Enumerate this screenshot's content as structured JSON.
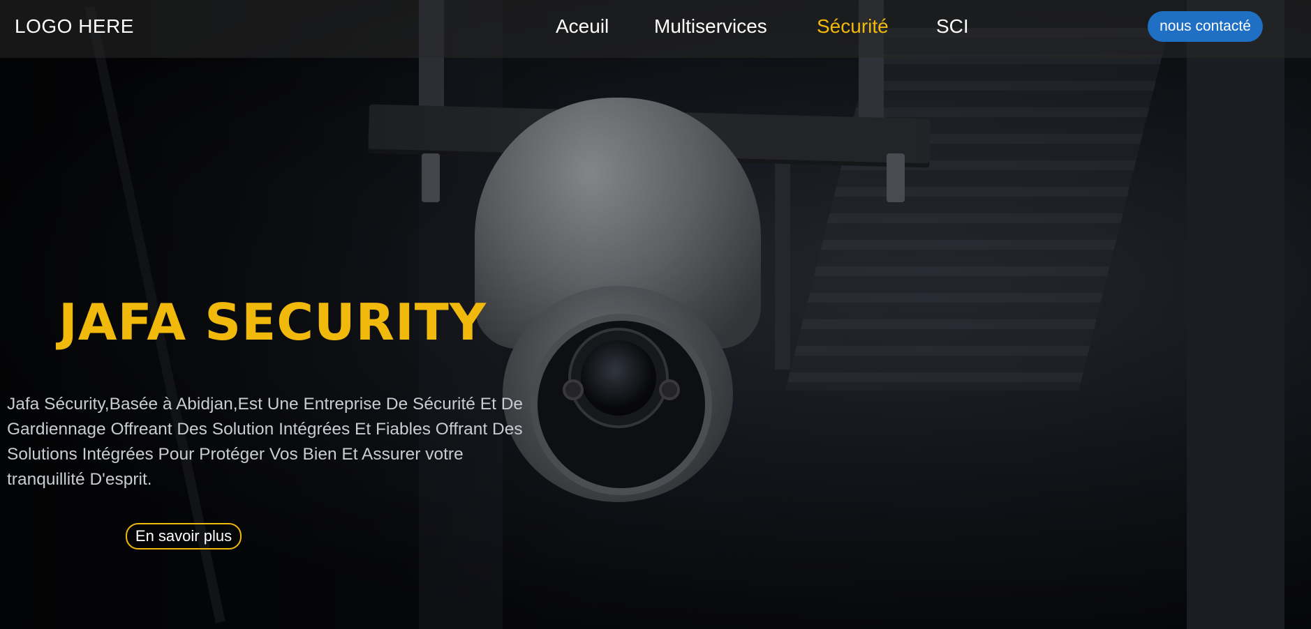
{
  "header": {
    "logo_text": "LOGO HERE",
    "nav": {
      "accueil": "Aceuil",
      "multiservices": "Multiservices",
      "securite": "Sécurité",
      "sci": "SCI"
    },
    "active_item": "Sécurité",
    "contact_button": "nous contacté"
  },
  "hero": {
    "title": "JAFA SECURITY",
    "description": "Jafa Sécurity,Basée à Abidjan,Est Une Entreprise De Sécurité Et De Gardiennage Offreant Des Solution Intégrées Et Fiables Offrant Des Solutions Intégrées Pour Protéger Vos Bien Et Assurer votre tranquillité D'esprit.",
    "cta_button": "En savoir plus",
    "background_image": "security-camera-photo"
  },
  "colors": {
    "accent": "#f0b90b",
    "contact_button": "#1f6fc5",
    "nav_text": "#ffffff",
    "background": "#07080b"
  }
}
